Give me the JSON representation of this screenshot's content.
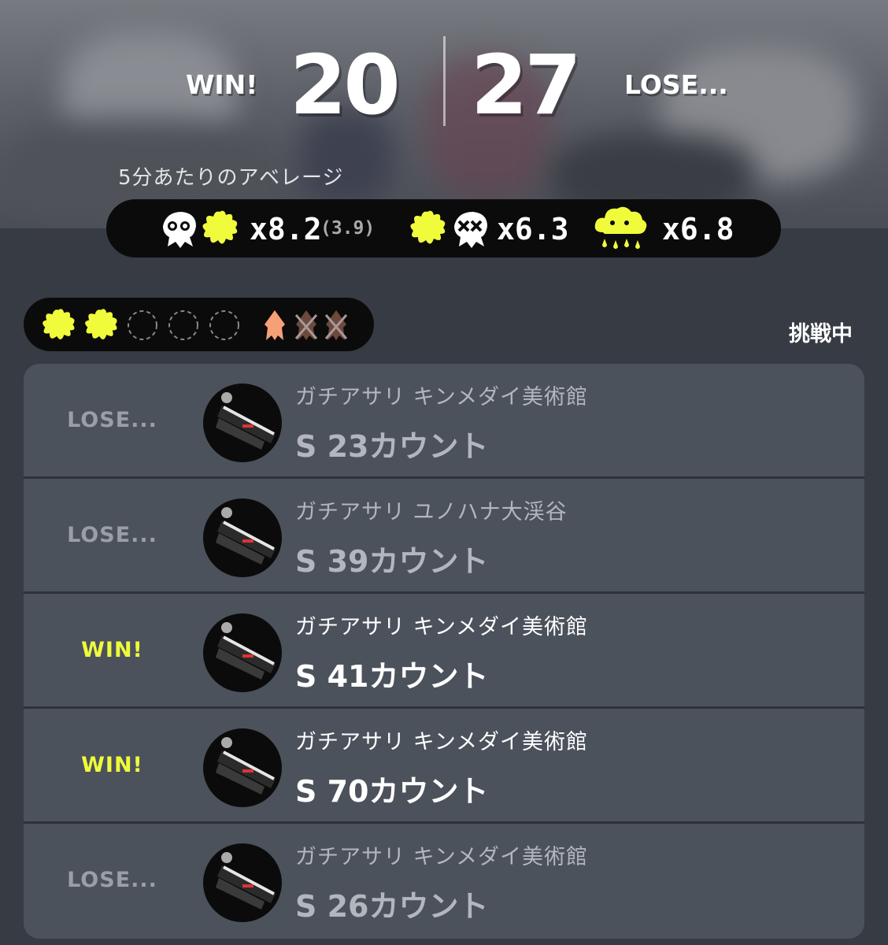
{
  "header": {
    "win_label": "WIN!",
    "win_count": "20",
    "lose_count": "27",
    "lose_label": "LOSE..."
  },
  "average": {
    "title": "5分あたりのアベレージ",
    "kills": "x8.2",
    "assists": "(3.9)",
    "deaths": "x6.3",
    "specials": "x6.8"
  },
  "streak": {
    "wins_shown": 2,
    "empty_slots": 3,
    "lives_remaining": 1,
    "lives_lost": 2,
    "status": "挑戦中"
  },
  "colors": {
    "accent_yellow": "#f0fb3c",
    "life_orange": "#f5a077",
    "life_lost": "#6b4a3c",
    "panel_bg": "#4c525c"
  },
  "matches": [
    {
      "result": "LOSE...",
      "mode_stage": "ガチアサリ キンメダイ美術館",
      "rank_count": "S 23カウント"
    },
    {
      "result": "LOSE...",
      "mode_stage": "ガチアサリ ユノハナ大渓谷",
      "rank_count": "S 39カウント"
    },
    {
      "result": "WIN!",
      "mode_stage": "ガチアサリ キンメダイ美術館",
      "rank_count": "S 41カウント"
    },
    {
      "result": "WIN!",
      "mode_stage": "ガチアサリ キンメダイ美術館",
      "rank_count": "S 70カウント"
    },
    {
      "result": "LOSE...",
      "mode_stage": "ガチアサリ キンメダイ美術館",
      "rank_count": "S 26カウント"
    }
  ]
}
